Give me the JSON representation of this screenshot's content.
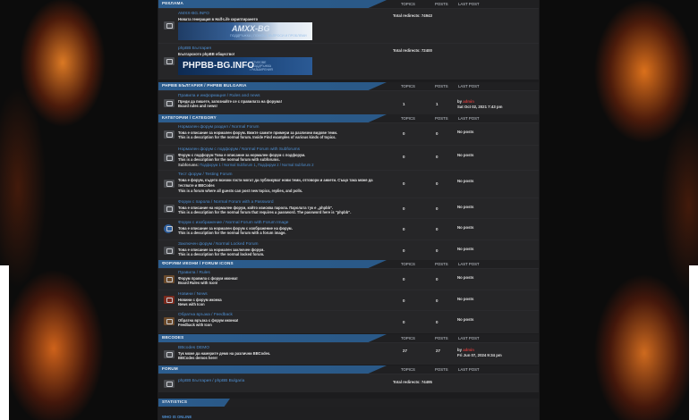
{
  "sections": {
    "advert": {
      "title": "РЕКЛАМА",
      "topics": "TOPICS",
      "posts": "POSTS",
      "last": "LAST POST"
    },
    "phpbb_bg": {
      "title": "PHPBB БЪЛГАРИЯ / PHPBB BULGARIA",
      "topics": "TOPICS",
      "posts": "POSTS",
      "last": "LAST POST"
    },
    "category": {
      "title": "КАТЕГОРИИ / CATEGORY",
      "topics": "TOPICS",
      "posts": "POSTS",
      "last": "LAST POST"
    },
    "icons": {
      "title": "ФОРУМИ ИКОНИ / FORUM ICONS",
      "topics": "TOPICS",
      "posts": "POSTS",
      "last": "LAST POST"
    },
    "bbcodes": {
      "title": "BBCODES",
      "topics": "TOPICS",
      "posts": "POSTS",
      "last": "LAST POST"
    },
    "forum": {
      "title": "FORUM",
      "topics": "TOPICS",
      "posts": "POSTS",
      "last": "LAST POST"
    },
    "statistics": {
      "title": "STATISTICS"
    },
    "who_online": {
      "title": "WHO IS ONLINE"
    }
  },
  "advert": [
    {
      "name": "AMXX-BG.INFO",
      "desc": "Новата генерация в Half-Life скриптирането",
      "redirects": "Total redirects: 74943",
      "banner_title": "AMXX-BG",
      "banner_sub": "ПОДДРЪЖКА | ПОМОЩ, ВЪПРОСИ И ПРОБЛЕМИ"
    },
    {
      "name": "phpBB България",
      "desc": "Българското phpBB общество!",
      "redirects": "Total redirects: 72400",
      "banner_title": "PHPBB-BG.INFO",
      "banner_sub": "• СТИЛОВЕ\n• ПОДДРЪЖКА\n• РАЗШИРЕНИЯ"
    }
  ],
  "rules": {
    "name": "Правила и информация / Rules and news",
    "desc1": "Преди да пишете, запознайте се с правилата на форума!",
    "desc2": "Board rules and news!",
    "topics": "1",
    "posts": "1",
    "by": "by",
    "user": "admin",
    "date": "Sat Oct 02, 2021 7:43 pm"
  },
  "category": [
    {
      "name": "Нормален форум раздел / Normal Forum",
      "d1": "Това е описание за нормален форум. Вижте самите примери за различни видове теми.",
      "d2": "This is a description for the normal forum. Inside Find examples of various kinds of topics.",
      "topics": "0",
      "posts": "0",
      "last": "No posts"
    },
    {
      "name": "Нормален форум с подфорум / Normal Forum with Subforums",
      "d1": "Форум с подфорум Това е описание за нормален форум с подфорум.",
      "d2": "This is a description for the normal forum with subforums.",
      "sub_label": "Subforums:",
      "sub1": "Подфорум 1 / Normal Subforum 1",
      "sub2": "Подфорум 2 / Normal Subforum 2",
      "topics": "0",
      "posts": "0",
      "last": "No posts"
    },
    {
      "name": "Тест форум / Testing Forum",
      "d1": "Това е форум, където всички гости могат да публикуват нови теми, отговори и анкети. Също така може да тествате и BBCodes",
      "d2": "This is a forum where all guests can post new topics, replies, and polls.",
      "topics": "0",
      "posts": "0",
      "last": "No posts"
    },
    {
      "name": "Форум с парола / Normal Forum with a Password",
      "d1": "Това е описание на нормален форум, който изисква парола. Паролата тук е „phpbb\".",
      "d2": "This is a description for the normal forum that requires a password. The password here is \"phpbb\".",
      "topics": "0",
      "posts": "0",
      "last": "No posts"
    },
    {
      "name": "Форум с изображение / Normal Forum with Forum Image",
      "d1": "Това е описание за нормален форум с изображение на форум.",
      "d2": "This is a description for the normal forum with a forum image.",
      "topics": "0",
      "posts": "0",
      "last": "No posts"
    },
    {
      "name": "Заключен форум / Normal Locked Forum",
      "d1": "Това е описание за нормален заключен форум.",
      "d2": "This is a description for the normal locked forum.",
      "topics": "0",
      "posts": "0",
      "last": "No posts"
    }
  ],
  "icons": [
    {
      "name": "Правила / Rules",
      "d1": "Форум правила с форум иконка!",
      "d2": "Board Rules with Icon!",
      "topics": "0",
      "posts": "0",
      "last": "No posts"
    },
    {
      "name": "Новини / News",
      "d1": "Новини с форум иконка",
      "d2": "News with Icon",
      "topics": "0",
      "posts": "0",
      "last": "No posts"
    },
    {
      "name": "Обратна връзка / Feedback",
      "d1": "Обратна връзка с форум иконка!",
      "d2": "Feedback with Icon",
      "topics": "0",
      "posts": "0",
      "last": "No posts"
    }
  ],
  "bbcodes": {
    "name": "BBcodes DEMO",
    "d1": "Тук може да намерите демо на различни BBCodes.",
    "d2": "BBCodes demos here!",
    "topics": "27",
    "posts": "27",
    "by": "by",
    "user": "admin",
    "date": "Fri Jun 07, 2024 9:34 pm"
  },
  "forum_link": {
    "name": "phpBB България / phpBB Bulgaria",
    "redirects": "Total redirects: 74495"
  },
  "colors": {
    "accent": "#2c5d8e",
    "link": "#4e8ed0",
    "user": "#cc3a3a"
  }
}
